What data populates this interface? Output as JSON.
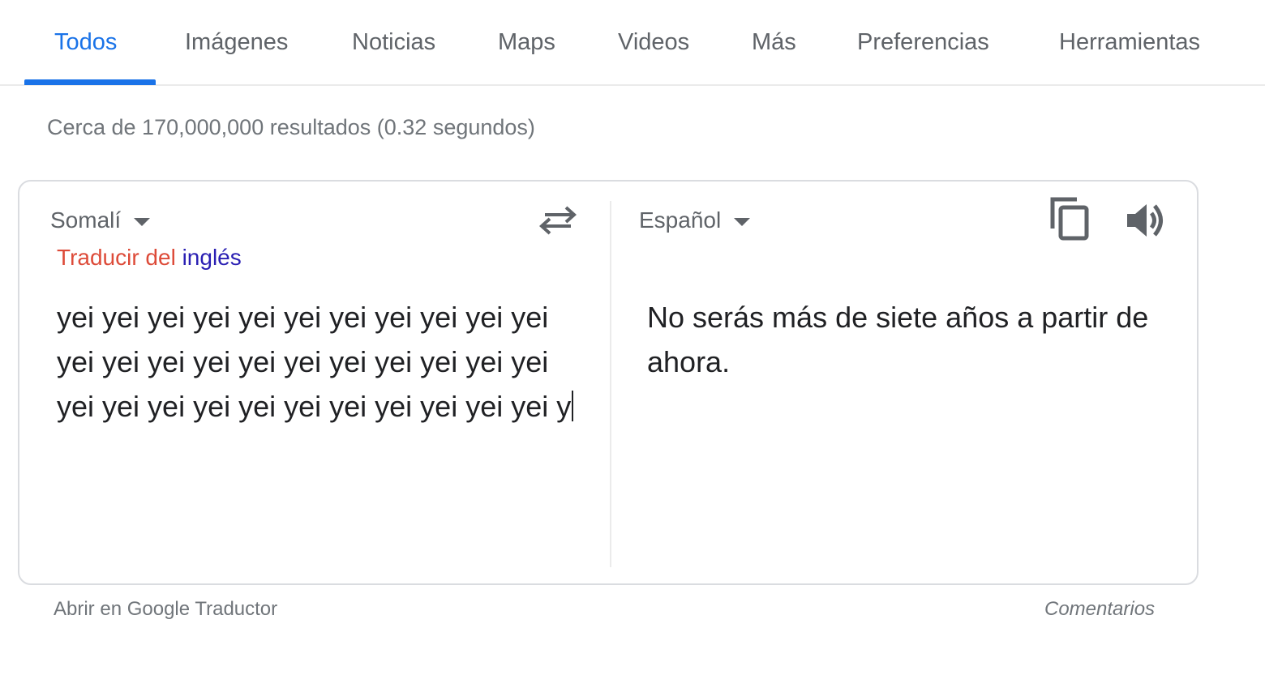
{
  "tabs": [
    {
      "label": "Todos"
    },
    {
      "label": "Imágenes"
    },
    {
      "label": "Noticias"
    },
    {
      "label": "Maps"
    },
    {
      "label": "Videos"
    },
    {
      "label": "Más"
    },
    {
      "label": "Preferencias"
    },
    {
      "label": "Herramientas"
    }
  ],
  "stats": "Cerca de 170,000,000 resultados (0.32 segundos)",
  "translator": {
    "source_lang": "Somalí",
    "detect_prefix": "Traducir del",
    "detect_lang": "inglés",
    "source_text": "yei yei yei yei yei yei yei yei yei yei yei yei yei yei yei yei yei yei yei yei yei yei yei yei yei yei yei yei yei yei yei yei yei y",
    "target_lang": "Español",
    "target_text": "No serás más de siete años a partir de ahora."
  },
  "footer": {
    "open_link": "Abrir en Google Traductor",
    "feedback": "Comentarios"
  },
  "colors": {
    "accent": "#1a73e8",
    "detect_prefix": "#dd4b39",
    "detect_lang": "#2a1fb3"
  },
  "icons": {
    "swap": "swap-arrows-icon",
    "copy": "copy-icon",
    "speaker": "speaker-icon"
  }
}
